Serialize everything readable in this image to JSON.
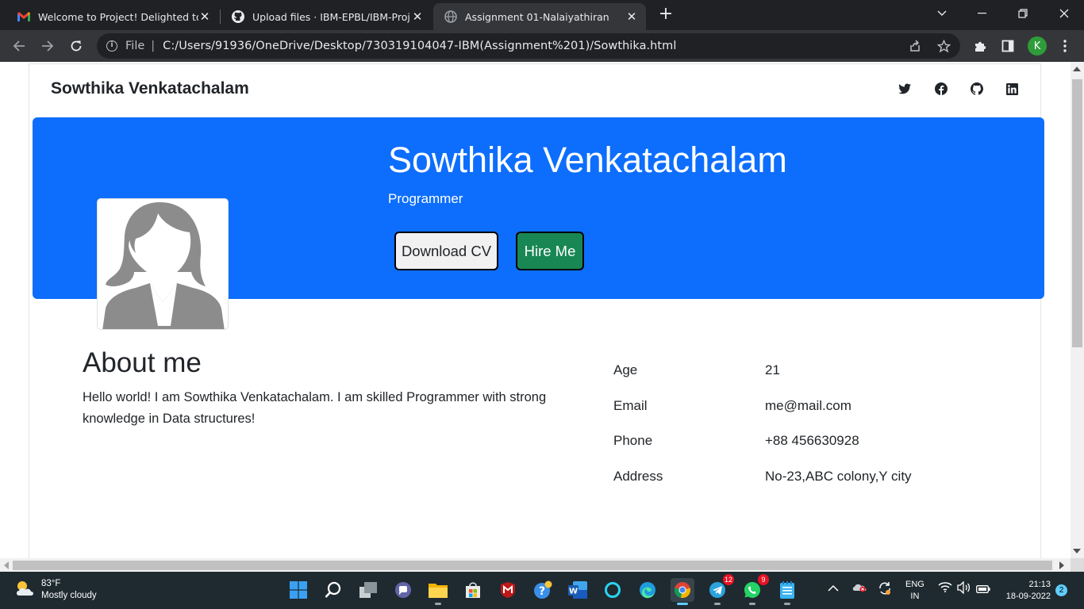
{
  "browser": {
    "tabs": [
      {
        "title": "Welcome to Project! Delighted to",
        "icon": "gmail-icon",
        "active": false
      },
      {
        "title": "Upload files · IBM-EPBL/IBM-Proj",
        "icon": "github-icon",
        "active": false
      },
      {
        "title": "Assignment 01-Nalaiyathiran",
        "icon": "globe-icon",
        "active": true
      }
    ],
    "address": {
      "scheme": "File",
      "url": "C:/Users/91936/OneDrive/Desktop/730319104047-IBM(Assignment%201)/Sowthika.html"
    },
    "profile_initial": "K"
  },
  "page": {
    "brand": "Sowthika Venkatachalam",
    "social": [
      "twitter-icon",
      "facebook-icon",
      "github-icon",
      "linkedin-icon"
    ],
    "hero": {
      "name": "Sowthika Venkatachalam",
      "role": "Programmer",
      "download_label": "Download CV",
      "hire_label": "Hire Me"
    },
    "about": {
      "heading": "About me",
      "text": "Hello world! I am Sowthika Venkatachalam. I am skilled Programmer with strong knowledge in Data structures!"
    },
    "info": [
      {
        "key": "Age",
        "value": "21"
      },
      {
        "key": "Email",
        "value": "me@mail.com"
      },
      {
        "key": "Phone",
        "value": "+88 456630928"
      },
      {
        "key": "Address",
        "value": "No-23,ABC colony,Y city"
      }
    ]
  },
  "taskbar": {
    "weather": {
      "temp": "83°F",
      "desc": "Mostly cloudy"
    },
    "apps": [
      {
        "name": "start-icon",
        "badge": ""
      },
      {
        "name": "search-icon",
        "badge": ""
      },
      {
        "name": "task-view-icon",
        "badge": ""
      },
      {
        "name": "teams-chat-icon",
        "badge": ""
      },
      {
        "name": "file-explorer-icon",
        "badge": ""
      },
      {
        "name": "store-icon",
        "badge": ""
      },
      {
        "name": "mcafee-icon",
        "badge": ""
      },
      {
        "name": "help-icon",
        "badge": ""
      },
      {
        "name": "word-icon",
        "badge": ""
      },
      {
        "name": "cortana-icon",
        "badge": ""
      },
      {
        "name": "edge-icon",
        "badge": ""
      },
      {
        "name": "chrome-icon",
        "badge": ""
      },
      {
        "name": "telegram-icon",
        "badge": "12"
      },
      {
        "name": "whatsapp-icon",
        "badge": "9"
      },
      {
        "name": "notepad-icon",
        "badge": ""
      }
    ],
    "language": {
      "line1": "ENG",
      "line2": "IN"
    },
    "clock": {
      "time": "21:13",
      "date": "18-09-2022"
    },
    "notifications": "2"
  },
  "colors": {
    "hero": "#0d6efd",
    "hire_button": "#198754",
    "tab_strip": "#202124",
    "toolbar": "#35363a",
    "taskbar": "#1f2a30"
  }
}
